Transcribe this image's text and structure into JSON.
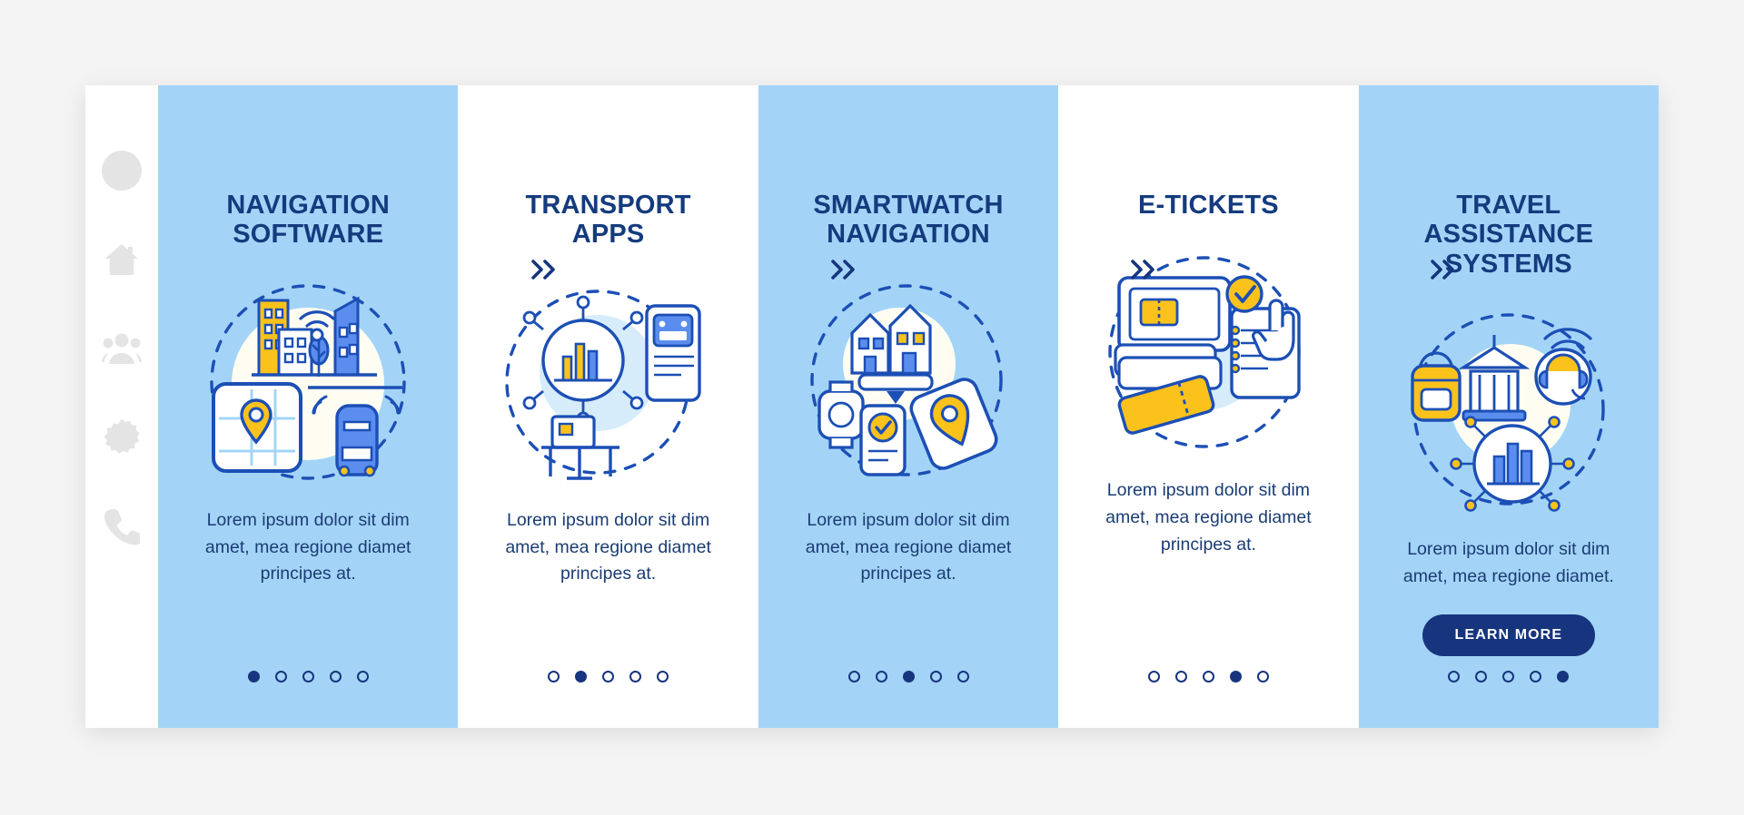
{
  "page": {
    "background_color": "#f4f4f4",
    "board_background": "#ffffff",
    "accent_blue": "#a3d4f7",
    "text_navy": "#143b7e",
    "yellow": "#fbc21b",
    "mid_blue": "#5b8def"
  },
  "sidebar": {
    "items": [
      {
        "icon": "user-avatar-icon",
        "label": "Profile"
      },
      {
        "icon": "home-icon",
        "label": "Home"
      },
      {
        "icon": "people-group-icon",
        "label": "Community"
      },
      {
        "icon": "gear-icon",
        "label": "Settings"
      },
      {
        "icon": "phone-icon",
        "label": "Contact"
      }
    ]
  },
  "separator": {
    "glyph": "double-chevron-right",
    "label": "»"
  },
  "cards": [
    {
      "title": "NAVIGATION SOFTWARE",
      "title_lines": [
        "NAVIGATION",
        "SOFTWARE"
      ],
      "body": "Lorem ipsum dolor sit dim amet, mea regione diamet principes at.",
      "illustration": "city-map-navigation-illustration",
      "theme": "blue",
      "dots": {
        "count": 5,
        "active_index": 0
      },
      "cta": null
    },
    {
      "title": "TRANSPORT APPS",
      "title_lines": [
        "TRANSPORT",
        "APPS"
      ],
      "body": "Lorem ipsum dolor sit dim amet, mea regione diamet principes at.",
      "illustration": "transport-apps-illustration",
      "theme": "white",
      "dots": {
        "count": 5,
        "active_index": 1
      },
      "cta": null
    },
    {
      "title": "SMARTWATCH NAVIGATION",
      "title_lines": [
        "SMARTWATCH",
        "NAVIGATION"
      ],
      "body": "Lorem ipsum dolor sit dim amet, mea regione diamet principes at.",
      "illustration": "smartwatch-navigation-illustration",
      "theme": "blue",
      "dots": {
        "count": 5,
        "active_index": 2
      },
      "cta": null
    },
    {
      "title": "E-TICKETS",
      "title_lines": [
        "E-TICKETS"
      ],
      "body": "Lorem ipsum dolor sit dim amet, mea regione diamet principes at.",
      "illustration": "e-tickets-illustration",
      "theme": "white",
      "dots": {
        "count": 5,
        "active_index": 3
      },
      "cta": null
    },
    {
      "title": "TRAVEL ASSISTANCE SYSTEMS",
      "title_lines": [
        "TRAVEL",
        "ASSISTANCE",
        "SYSTEMS"
      ],
      "body": "Lorem ipsum dolor sit dim amet, mea regione diamet.",
      "illustration": "travel-assistance-illustration",
      "theme": "blue",
      "dots": {
        "count": 5,
        "active_index": 4
      },
      "cta": "LEARN MORE"
    }
  ]
}
